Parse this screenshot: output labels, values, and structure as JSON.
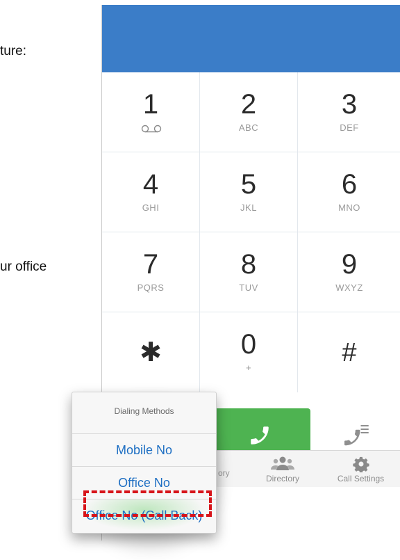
{
  "doc": {
    "line1": "ture:",
    "line2": "ur office"
  },
  "keypad": [
    {
      "digit": "1",
      "letters": "",
      "voicemail": true
    },
    {
      "digit": "2",
      "letters": "ABC"
    },
    {
      "digit": "3",
      "letters": "DEF"
    },
    {
      "digit": "4",
      "letters": "GHI"
    },
    {
      "digit": "5",
      "letters": "JKL"
    },
    {
      "digit": "6",
      "letters": "MNO"
    },
    {
      "digit": "7",
      "letters": "PQRS"
    },
    {
      "digit": "8",
      "letters": "TUV"
    },
    {
      "digit": "9",
      "letters": "WXYZ"
    },
    {
      "digit": "✱",
      "letters": "",
      "symbol": true
    },
    {
      "digit": "0",
      "letters": "+"
    },
    {
      "digit": "#",
      "letters": "",
      "symbol": true
    }
  ],
  "tabs": {
    "history_partial": "ory",
    "directory": "Directory",
    "call_settings": "Call Settings"
  },
  "popup": {
    "title": "Dialing Methods",
    "options": [
      "Mobile No",
      "Office No",
      "Office No (Call Back)"
    ]
  },
  "colors": {
    "header": "#3b7dc8",
    "call_button": "#4eb351",
    "link": "#1e6fc3",
    "highlight": "#d7141a"
  },
  "icons": {
    "call": "phone-icon",
    "contacts": "phone-list-icon",
    "directory": "people-icon",
    "settings": "gear-icon",
    "voicemail": "voicemail-icon"
  }
}
